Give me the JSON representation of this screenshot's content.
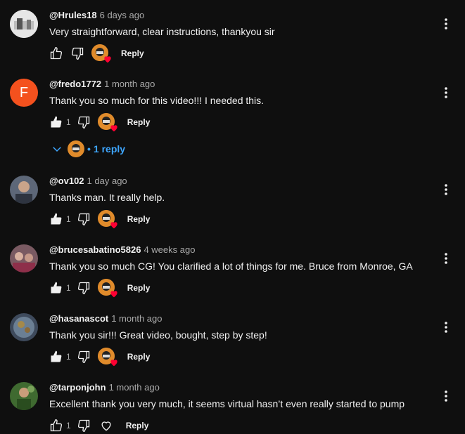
{
  "comments": [
    {
      "handle": "@Hrules18",
      "time": "6 days ago",
      "text": "Very straightforward, clear instructions, thankyou sir",
      "likes": "",
      "reply_label": "Reply",
      "avatar": {
        "kind": "photo",
        "color": "#d8d8d8"
      }
    },
    {
      "handle": "@fredo1772",
      "time": "1 month ago",
      "text": "Thank you so much for this video!!! I needed this.",
      "likes": "1",
      "reply_label": "Reply",
      "avatar": {
        "kind": "letter",
        "letter": "F",
        "color": "#f4511e"
      },
      "replies_label": "1 reply"
    },
    {
      "handle": "@ov102",
      "time": "1 day ago",
      "text": "Thanks man. It really help.",
      "likes": "1",
      "reply_label": "Reply",
      "avatar": {
        "kind": "photo",
        "color": "#6c7a8c"
      }
    },
    {
      "handle": "@brucesabatino5826",
      "time": "4 weeks ago",
      "text": "Thank you so much CG!  You clarified a lot of things for me.  Bruce from Monroe, GA",
      "likes": "1",
      "reply_label": "Reply",
      "avatar": {
        "kind": "photo",
        "color": "#8a6a6e"
      }
    },
    {
      "handle": "@hasanascot",
      "time": "1 month ago",
      "text": "Thank you sir!!! Great video, bought, step by step!",
      "likes": "1",
      "reply_label": "Reply",
      "avatar": {
        "kind": "photo",
        "color": "#556070"
      }
    },
    {
      "handle": "@tarponjohn",
      "time": "1 month ago",
      "text": "Excellent thank you very much, it seems virtual hasn’t even really started to pump",
      "likes": "1",
      "reply_label": "Reply",
      "avatar": {
        "kind": "photo",
        "color": "#4a7a3a"
      }
    }
  ],
  "colors": {
    "background": "#0f0f0f",
    "text": "#f1f1f1",
    "secondary": "#aaaaaa",
    "link": "#3ea6ff",
    "heart": "#ff0033",
    "creator_avatar": "#e08b2b"
  },
  "icons": [
    "thumbs-up-icon",
    "thumbs-down-icon",
    "creator-heart-icon",
    "more-vert-icon",
    "chevron-down-icon"
  ]
}
